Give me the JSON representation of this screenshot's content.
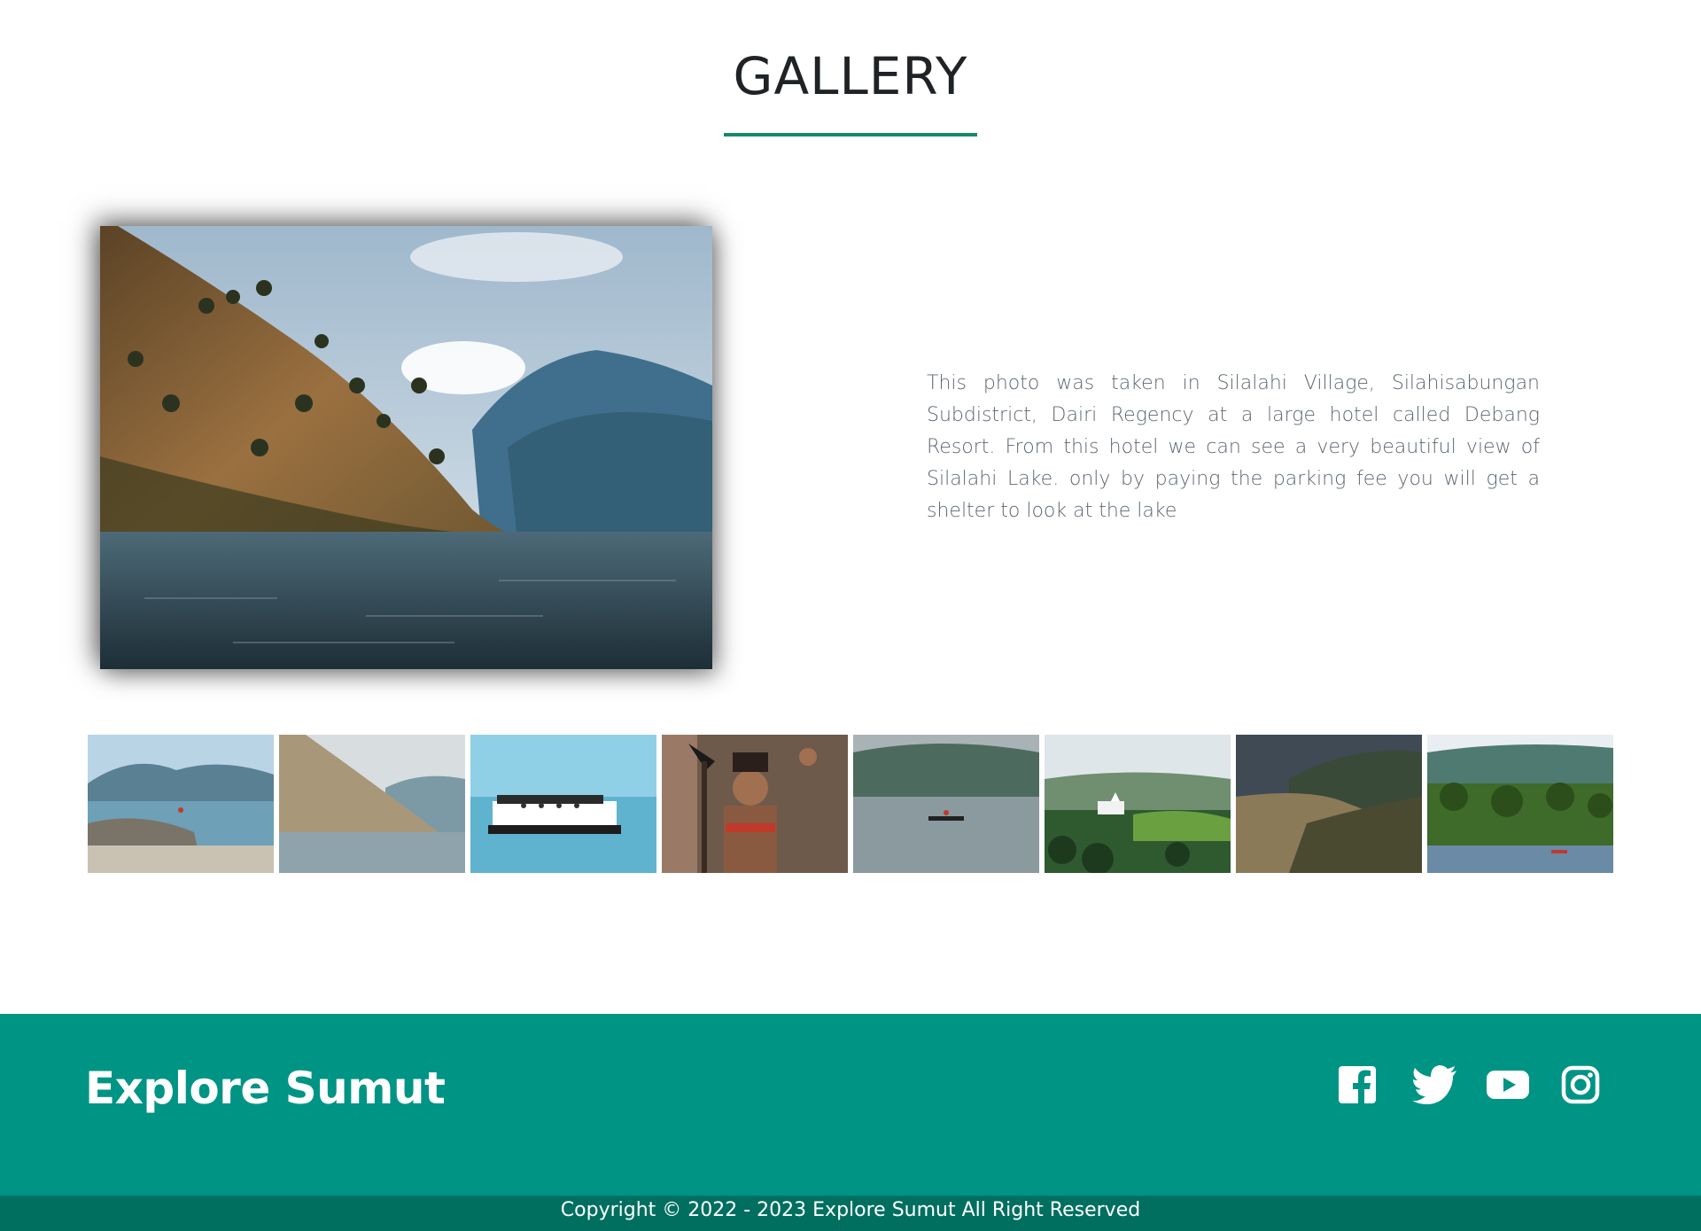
{
  "page": {
    "title": "GALLERY",
    "accent_color": "#148a6c"
  },
  "gallery": {
    "main_image_icon": "lake-mountain-photo",
    "description": "This photo was taken in Silalahi Village, Silahisabungan Subdistrict, Dairi Regency at a large hotel called Debang Resort. From this hotel we can see a very beautiful view of Silalahi Lake. only by paying the parking fee you will get a shelter to look at the lake",
    "thumbnails": [
      {
        "icon": "lake-shore-rocks-photo"
      },
      {
        "icon": "hillside-lake-photo"
      },
      {
        "icon": "ferry-boat-photo"
      },
      {
        "icon": "batak-warrior-photo"
      },
      {
        "icon": "canoe-on-lake-photo"
      },
      {
        "icon": "village-church-hills-photo"
      },
      {
        "icon": "lake-bay-sunset-photo"
      },
      {
        "icon": "green-shore-boats-photo"
      }
    ]
  },
  "footer": {
    "brand": "Explore Sumut",
    "background_color": "#009485",
    "social_icons": [
      "facebook-icon",
      "twitter-icon",
      "youtube-icon",
      "instagram-icon"
    ],
    "copyright": "Copyright © 2022 - 2023 Explore Sumut All Right Reserved"
  }
}
